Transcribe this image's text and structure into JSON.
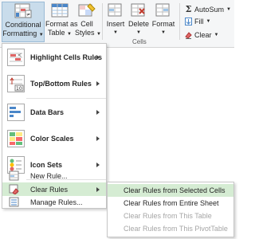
{
  "ribbon": {
    "conditional_formatting": {
      "line1": "Conditional",
      "line2": "Formatting",
      "icon": "conditional-formatting-icon"
    },
    "format_as_table": {
      "line1": "Format as",
      "line2": "Table"
    },
    "cell_styles": {
      "line1": "Cell",
      "line2": "Styles"
    },
    "insert": {
      "label": "Insert"
    },
    "delete": {
      "label": "Delete"
    },
    "format": {
      "label": "Format"
    },
    "cells_group_label": "Cells",
    "autosum": {
      "label": "AutoSum",
      "icon": "sigma-icon"
    },
    "fill": {
      "label": "Fill"
    },
    "clear": {
      "label": "Clear"
    }
  },
  "menu": {
    "items": [
      {
        "label": "Highlight Cells Rules",
        "icon": "highlight-cells-rules-icon",
        "submenu": true
      },
      {
        "label": "Top/Bottom Rules",
        "icon": "top-bottom-rules-icon",
        "submenu": true
      },
      {
        "label": "Data Bars",
        "icon": "data-bars-icon",
        "submenu": true
      },
      {
        "label": "Color Scales",
        "icon": "color-scales-icon",
        "submenu": true
      },
      {
        "label": "Icon Sets",
        "icon": "icon-sets-icon",
        "submenu": true
      },
      {
        "label": "New Rule...",
        "icon": "new-rule-icon",
        "submenu": false
      },
      {
        "label": "Clear Rules",
        "icon": "clear-rules-icon",
        "submenu": true,
        "highlighted": true
      },
      {
        "label": "Manage Rules...",
        "icon": "manage-rules-icon",
        "submenu": false
      }
    ]
  },
  "submenu": {
    "items": [
      {
        "label": "Clear Rules from Selected Cells",
        "enabled": true,
        "highlighted": true
      },
      {
        "label": "Clear Rules from Entire Sheet",
        "enabled": true
      },
      {
        "label": "Clear Rules from This Table",
        "enabled": false
      },
      {
        "label": "Clear Rules from This PivotTable",
        "enabled": false
      }
    ]
  },
  "colors": {
    "highlight": "#d5ecd3",
    "accent_green": "#217346",
    "disabled_text": "#a6a6a6"
  }
}
